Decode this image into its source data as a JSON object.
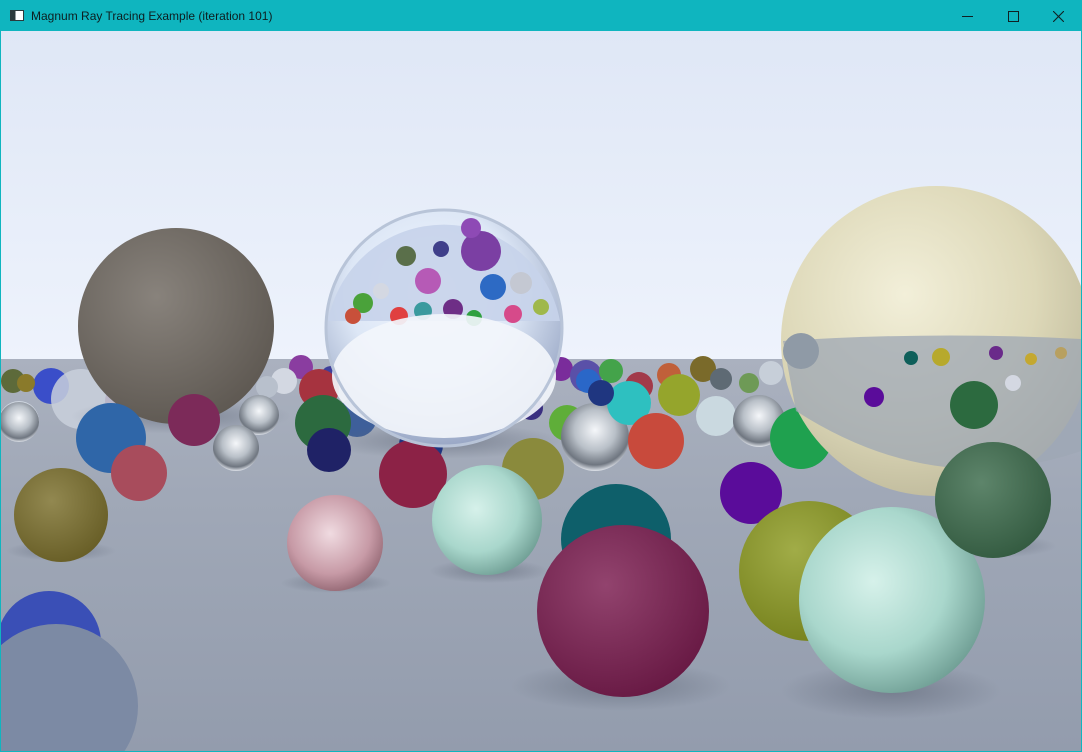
{
  "window": {
    "title": "Magnum Ray Tracing Example (iteration 101)",
    "accent_color": "#0fb5bf",
    "controls": {
      "minimize_icon": "minimize-icon",
      "maximize_icon": "maximize-icon",
      "close_icon": "close-icon"
    }
  },
  "scene": {
    "description_icon": "render-viewport",
    "sky_top_color": "#dde6f5",
    "horizon_color": "#edf2fb",
    "ground_color": "#9aa3b3"
  }
}
